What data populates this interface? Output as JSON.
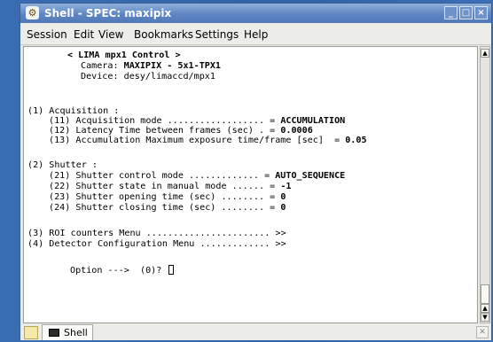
{
  "window": {
    "title": "Shell - SPEC: maxipix",
    "controls": {
      "minimize": "_",
      "maximize": "□",
      "close": "×"
    }
  },
  "menubar": [
    "Session",
    "Edit",
    "View",
    "Bookmarks",
    "Settings",
    "Help"
  ],
  "terminal": {
    "header": {
      "title": "< LIMA mpx1 Control >",
      "camera_label": "Camera: ",
      "camera_value": "MAXIPIX - 5x1-TPX1",
      "device": "Device: desy/limaccd/mpx1"
    },
    "acquisition": {
      "heading": "(1) Acquisition :",
      "items": [
        {
          "label": "(11) Acquisition mode .................. = ",
          "value": "ACCUMULATION"
        },
        {
          "label": "(12) Latency Time between frames (sec) . = ",
          "value": "0.0006"
        },
        {
          "label": "(13) Accumulation Maximum exposure time/frame [sec]  = ",
          "value": "0.05"
        }
      ]
    },
    "shutter": {
      "heading": "(2) Shutter :",
      "items": [
        {
          "label": "(21) Shutter control mode ............. = ",
          "value": "AUTO_SEQUENCE"
        },
        {
          "label": "(22) Shutter state in manual mode ...... = ",
          "value": "-1"
        },
        {
          "label": "(23) Shutter opening time (sec) ........ = ",
          "value": "0"
        },
        {
          "label": "(24) Shutter closing time (sec) ........ = ",
          "value": "0"
        }
      ]
    },
    "menus": [
      "(3) ROI counters Menu ....................... >>",
      "(4) Detector Configuration Menu ............. >>"
    ],
    "prompt": "Option --->  (0)? "
  },
  "tabbar": {
    "tab_label": "Shell"
  }
}
